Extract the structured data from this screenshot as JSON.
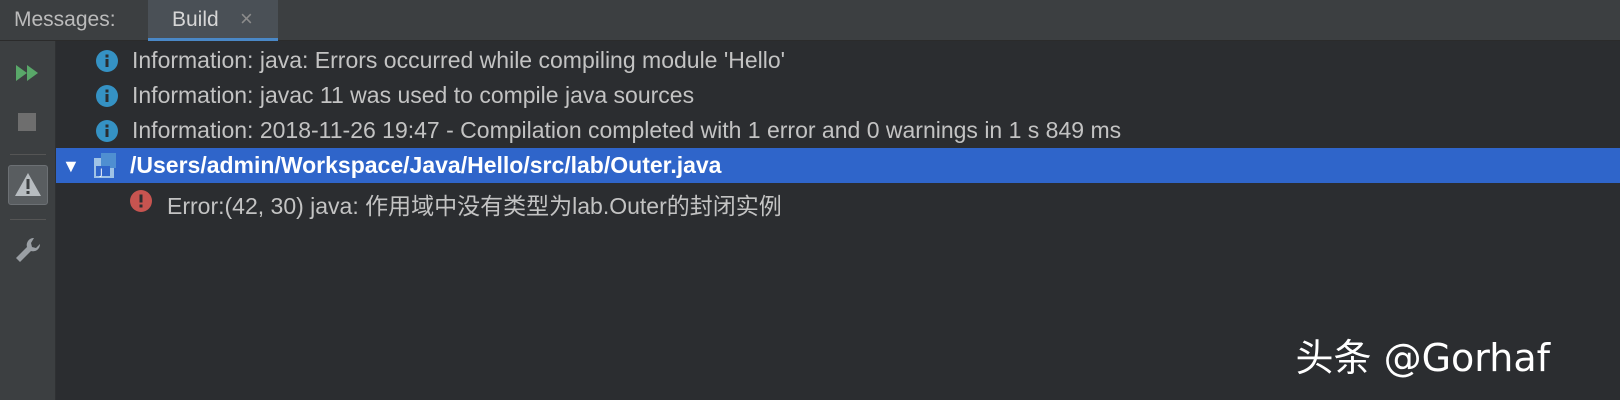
{
  "tabbar": {
    "title": "Messages:",
    "active_tab": {
      "label": "Build",
      "close_glyph": "×"
    }
  },
  "toolbar": {
    "items": [
      {
        "icon": "rerun-icon",
        "color": "#59a869"
      },
      {
        "icon": "stop-icon",
        "color": "#6e6e6e"
      },
      {
        "icon": "warning-filter-icon",
        "color": "#a9b7c6"
      },
      {
        "icon": "settings-wrench-icon",
        "color": "#a9b7c6"
      }
    ]
  },
  "messages": {
    "rows": [
      {
        "type": "info",
        "icon": "info-icon",
        "text": "Information: java: Errors occurred while compiling module 'Hello'"
      },
      {
        "type": "info",
        "icon": "info-icon",
        "text": "Information: javac 11 was used to compile java sources"
      },
      {
        "type": "info",
        "icon": "info-icon",
        "text": "Information: 2018-11-26 19:47 - Compilation completed with 1 error and 0 warnings in 1 s 849 ms"
      },
      {
        "type": "file",
        "icon": "java-file-icon",
        "text": "/Users/admin/Workspace/Java/Hello/src/lab/Outer.java",
        "expanded": true
      },
      {
        "type": "error",
        "icon": "error-icon",
        "text": "Error:(42, 30)  java: 作用域中没有类型为lab.Outer的封闭实例"
      }
    ]
  },
  "watermark": "头条 @Gorhaf",
  "colors": {
    "info_icon": "#3592c4",
    "error_icon": "#c75450",
    "selected_row": "#2f65ca",
    "background": "#2b2d30"
  }
}
